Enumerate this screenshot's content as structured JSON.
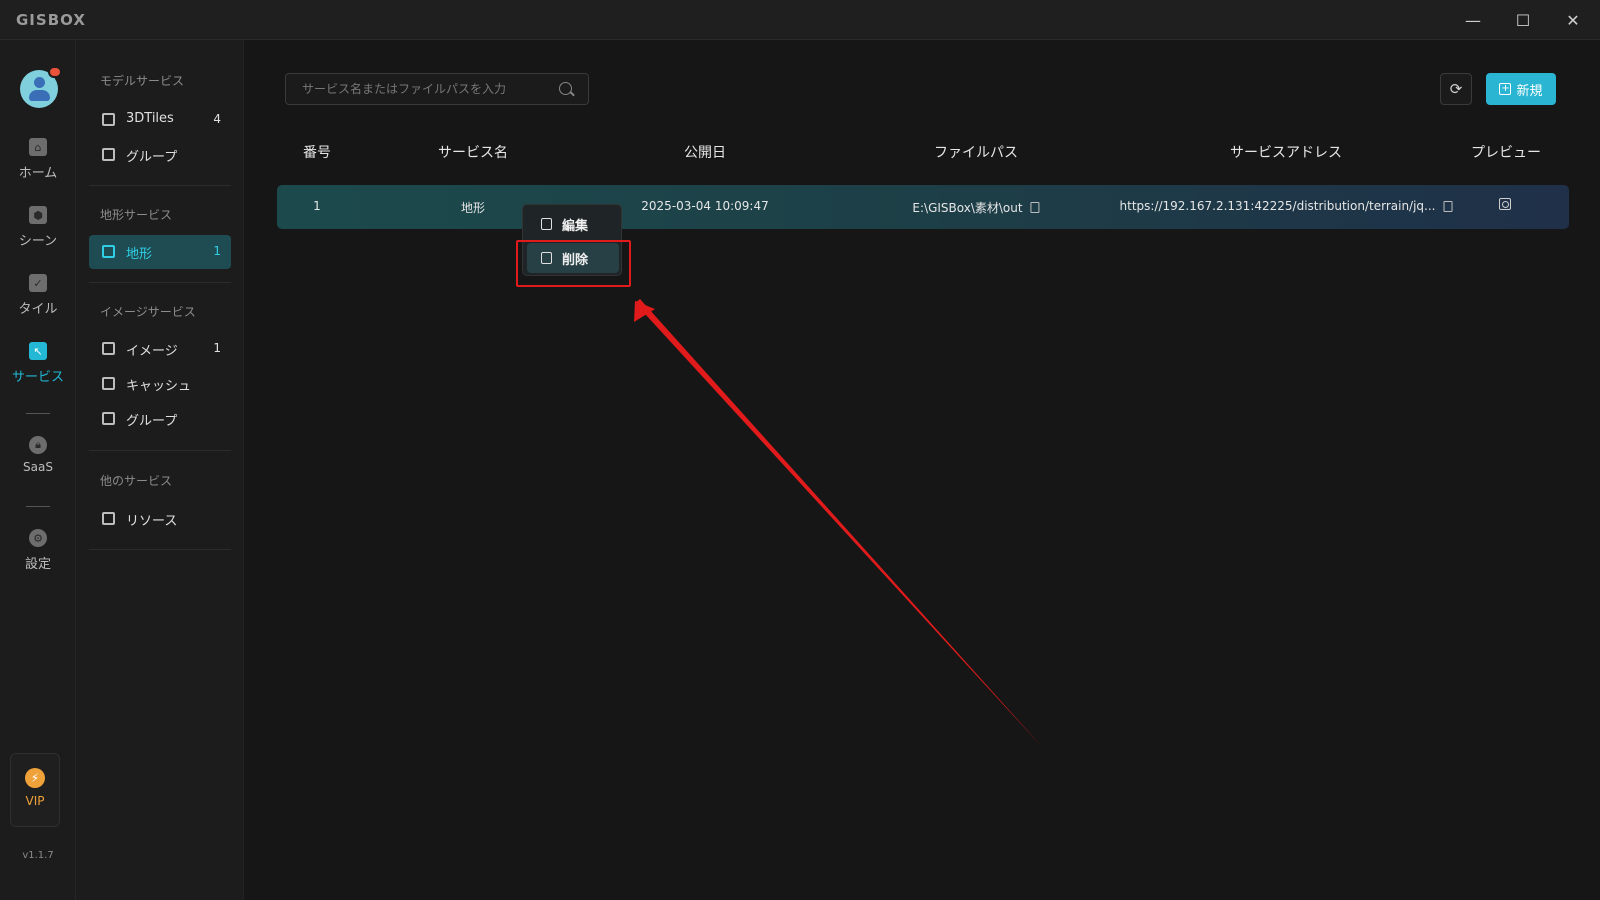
{
  "app": {
    "logo": "GISBOX",
    "window_controls": {
      "minimize": "—",
      "maximize": "☐",
      "close": "✕"
    }
  },
  "rail": {
    "items": [
      {
        "label": "ホーム",
        "icon": "home-icon"
      },
      {
        "label": "シーン",
        "icon": "scene-icon"
      },
      {
        "label": "タイル",
        "icon": "tile-icon"
      },
      {
        "label": "サービス",
        "icon": "service-icon"
      },
      {
        "label": "SaaS",
        "icon": "lock-icon"
      },
      {
        "label": "設定",
        "icon": "settings-icon"
      }
    ],
    "active": "サービス",
    "vip_label": "VIP",
    "version": "v1.1.7"
  },
  "sidebar": {
    "sections": [
      {
        "title": "モデルサービス",
        "items": [
          {
            "label": "3DTiles",
            "count": "4"
          },
          {
            "label": "グループ",
            "count": ""
          }
        ]
      },
      {
        "title": "地形サービス",
        "items": [
          {
            "label": "地形",
            "count": "1"
          }
        ]
      },
      {
        "title": "イメージサービス",
        "items": [
          {
            "label": "イメージ",
            "count": "1"
          },
          {
            "label": "キャッシュ",
            "count": ""
          },
          {
            "label": "グループ",
            "count": ""
          }
        ]
      },
      {
        "title": "他のサービス",
        "items": [
          {
            "label": "リソース",
            "count": ""
          }
        ]
      }
    ],
    "active_item": "地形"
  },
  "toolbar": {
    "search_placeholder": "サービス名またはファイルパスを入力",
    "refresh_icon": "refresh-icon",
    "new_label": "新規"
  },
  "table": {
    "columns": [
      "番号",
      "サービス名",
      "公開日",
      "ファイルパス",
      "サービスアドレス",
      "プレビュー"
    ],
    "rows": [
      {
        "number": "1",
        "name": "地形",
        "date": "2025-03-04 10:09:47",
        "path": "E:\\GISBox\\素材\\out",
        "address": "https://192.167.2.131:42225/distribution/terrain/jq..."
      }
    ]
  },
  "context_menu": {
    "items": [
      {
        "label": "編集",
        "icon": "edit-icon"
      },
      {
        "label": "削除",
        "icon": "trash-icon"
      }
    ],
    "hovered": "削除"
  },
  "annotation": {
    "color": "#e11b1b"
  },
  "colors": {
    "accent": "#2ab6d2",
    "vip": "#f0a23a"
  }
}
